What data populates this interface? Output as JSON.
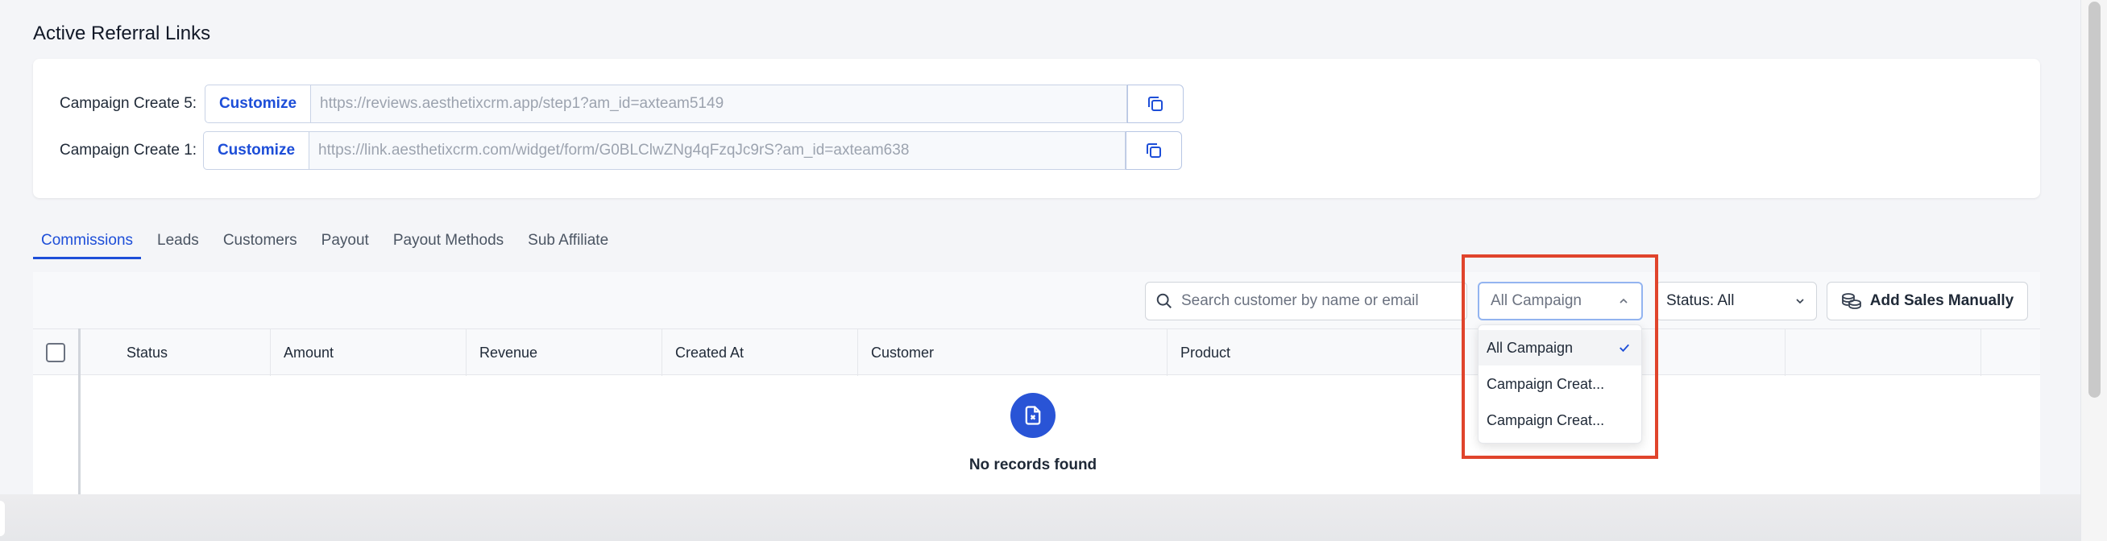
{
  "page": {
    "title": "Active Referral Links"
  },
  "referral_links": [
    {
      "label": "Campaign Create 5:",
      "customize_label": "Customize",
      "url": "https://reviews.aesthetixcrm.app/step1?am_id=axteam5149"
    },
    {
      "label": "Campaign Create 1:",
      "customize_label": "Customize",
      "url": "https://link.aesthetixcrm.com/widget/form/G0BLClwZNg4qFzqJc9rS?am_id=axteam638"
    }
  ],
  "tabs": [
    {
      "label": "Commissions",
      "active": true
    },
    {
      "label": "Leads"
    },
    {
      "label": "Customers"
    },
    {
      "label": "Payout"
    },
    {
      "label": "Payout Methods"
    },
    {
      "label": "Sub Affiliate"
    }
  ],
  "toolbar": {
    "search_placeholder": "Search customer by name or email",
    "campaign_value": "All Campaign",
    "status_value": "Status: All",
    "add_sales_label": "Add Sales Manually"
  },
  "table": {
    "columns": [
      "Status",
      "Amount",
      "Revenue",
      "Created At",
      "Customer",
      "Product"
    ],
    "empty_text": "No records found"
  },
  "campaign_dropdown": {
    "options": [
      {
        "label": "All Campaign",
        "selected": true
      },
      {
        "label": "Campaign Creat..."
      },
      {
        "label": "Campaign Creat..."
      }
    ]
  },
  "colors": {
    "accent": "#1d4ed8",
    "highlight": "#e0442c"
  }
}
